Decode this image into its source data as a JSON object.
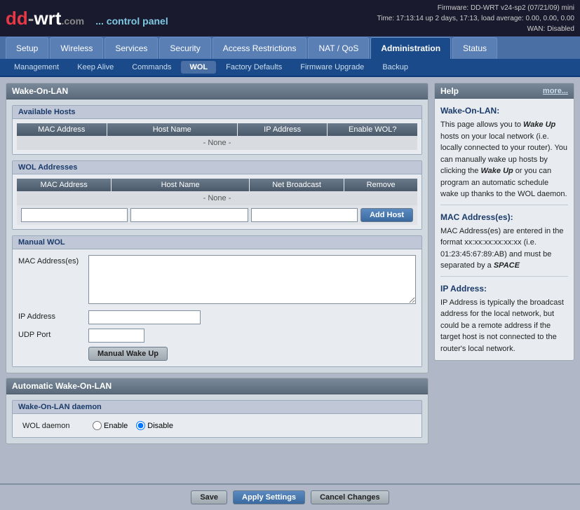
{
  "header": {
    "logo": "dd-wrt.com",
    "tagline": "... control panel",
    "firmware": "Firmware: DD-WRT v24-sp2 (07/21/09) mini",
    "time": "Time: 17:13:14 up 2 days, 17:13, load average: 0.00, 0.00, 0.00",
    "wan": "WAN: Disabled"
  },
  "nav": {
    "tabs": [
      {
        "id": "setup",
        "label": "Setup"
      },
      {
        "id": "wireless",
        "label": "Wireless"
      },
      {
        "id": "services",
        "label": "Services"
      },
      {
        "id": "security",
        "label": "Security"
      },
      {
        "id": "access-restrictions",
        "label": "Access Restrictions"
      },
      {
        "id": "nat-qos",
        "label": "NAT / QoS"
      },
      {
        "id": "administration",
        "label": "Administration",
        "active": true
      },
      {
        "id": "status",
        "label": "Status"
      }
    ]
  },
  "subnav": {
    "tabs": [
      {
        "id": "management",
        "label": "Management"
      },
      {
        "id": "keep-alive",
        "label": "Keep Alive"
      },
      {
        "id": "commands",
        "label": "Commands"
      },
      {
        "id": "wol",
        "label": "WOL",
        "active": true
      },
      {
        "id": "factory-defaults",
        "label": "Factory Defaults"
      },
      {
        "id": "firmware-upgrade",
        "label": "Firmware Upgrade"
      },
      {
        "id": "backup",
        "label": "Backup"
      }
    ]
  },
  "main": {
    "page_title": "Wake-On-LAN",
    "available_hosts": {
      "title": "Available Hosts",
      "columns": [
        "MAC Address",
        "Host Name",
        "IP Address",
        "Enable WOL?"
      ],
      "empty_label": "- None -"
    },
    "wol_addresses": {
      "title": "WOL Addresses",
      "columns": [
        "MAC Address",
        "Host Name",
        "Net Broadcast",
        "Remove"
      ],
      "empty_label": "- None -",
      "add_host_button": "Add Host"
    },
    "manual_wol": {
      "title": "Manual WOL",
      "mac_label": "MAC Address(es)",
      "ip_label": "IP Address",
      "udp_label": "UDP Port",
      "wake_button": "Manual Wake Up"
    },
    "automatic": {
      "title": "Automatic Wake-On-LAN",
      "daemon_section": "Wake-On-LAN daemon",
      "daemon_label": "WOL daemon",
      "enable_label": "Enable",
      "disable_label": "Disable",
      "daemon_value": "disable"
    }
  },
  "help": {
    "title": "Help",
    "more_label": "more...",
    "wol_title": "Wake-On-LAN:",
    "wol_text": "This page allows you to Wake Up hosts on your local network (i.e. locally connected to your router). You can manually wake up hosts by clicking the Wake Up or you can program an automatic schedule wake up thanks to the WOL daemon.",
    "mac_title": "MAC Address(es):",
    "mac_text": "MAC Address(es) are entered in the format xx:xx:xx:xx:xx:xx (i.e. 01:23:45:67:89:AB) and must be separated by a SPACE",
    "ip_title": "IP Address:",
    "ip_text": "IP Address is typically the broadcast address for the local network, but could be a remote address if the target host is not connected to the router's local network."
  },
  "footer": {
    "save_label": "Save",
    "apply_label": "Apply Settings",
    "cancel_label": "Cancel Changes"
  }
}
